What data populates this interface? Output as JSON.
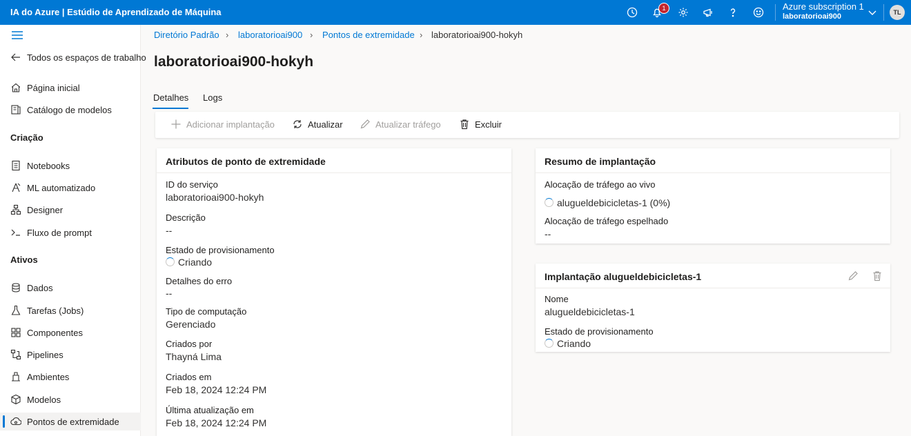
{
  "app": {
    "title": "IA do Azure | Estúdio de Aprendizado de Máquina"
  },
  "header": {
    "notification_count": "1",
    "subscription": "Azure subscription 1",
    "workspace": "laboratorioai900",
    "user_initials": "TL",
    "icons": [
      "clock-icon",
      "bell-icon",
      "gear-icon",
      "megaphone-icon",
      "help-icon",
      "smiley-icon",
      "chevron-down-icon"
    ]
  },
  "sidebar": {
    "back_label": "Todos os espaços de trabalho",
    "top_items": [
      {
        "label": "Página inicial",
        "icon": "home-icon"
      },
      {
        "label": "Catálogo de modelos",
        "icon": "catalog-icon"
      }
    ],
    "section_create": "Criação",
    "create_items": [
      {
        "label": "Notebooks",
        "icon": "notebook-icon"
      },
      {
        "label": "ML automatizado",
        "icon": "automl-icon"
      },
      {
        "label": "Designer",
        "icon": "designer-icon"
      },
      {
        "label": "Fluxo de prompt",
        "icon": "prompt-icon"
      }
    ],
    "section_assets": "Ativos",
    "asset_items": [
      {
        "label": "Dados",
        "icon": "data-icon"
      },
      {
        "label": "Tarefas (Jobs)",
        "icon": "flask-icon"
      },
      {
        "label": "Componentes",
        "icon": "components-icon"
      },
      {
        "label": "Pipelines",
        "icon": "pipeline-icon"
      },
      {
        "label": "Ambientes",
        "icon": "environment-icon"
      },
      {
        "label": "Modelos",
        "icon": "cube-icon"
      },
      {
        "label": "Pontos de extremidade",
        "icon": "endpoint-icon"
      }
    ]
  },
  "breadcrumb": [
    "Diretório Padrão",
    "laboratorioai900",
    "Pontos de extremidade",
    "laboratorioai900-hokyh"
  ],
  "page": {
    "title": "laboratorioai900-hokyh"
  },
  "tabs": [
    "Detalhes",
    "Logs"
  ],
  "toolbar": {
    "add_deployment": "Adicionar implantação",
    "refresh": "Atualizar",
    "update_traffic": "Atualizar tráfego",
    "delete": "Excluir"
  },
  "attributes": {
    "title": "Atributos de ponto de extremidade",
    "fields": [
      {
        "label": "ID do serviço",
        "value": "laboratorioai900-hokyh"
      },
      {
        "label": "Descrição",
        "value": "--"
      },
      {
        "label": "Estado de provisionamento",
        "value": "Criando"
      },
      {
        "label": "Detalhes do erro",
        "value": "--"
      },
      {
        "label": "Tipo de computação",
        "value": "Gerenciado"
      },
      {
        "label": "Criados por",
        "value": "Thayná Lima"
      },
      {
        "label": "Criados em",
        "value": "Feb 18, 2024 12:24 PM"
      },
      {
        "label": "Última atualização em",
        "value": "Feb 18, 2024 12:24 PM"
      }
    ]
  },
  "summary": {
    "title": "Resumo de implantação",
    "live_label": "Alocação de tráfego ao vivo",
    "live_value": "alugueldebicicletas-1 (0%)",
    "mirror_label": "Alocação de tráfego espelhado",
    "mirror_value": "--"
  },
  "deployment": {
    "title": "Implantação alugueldebicicletas-1",
    "name_label": "Nome",
    "name_value": "alugueldebicicletas-1",
    "state_label": "Estado de provisionamento",
    "state_value": "Criando"
  }
}
